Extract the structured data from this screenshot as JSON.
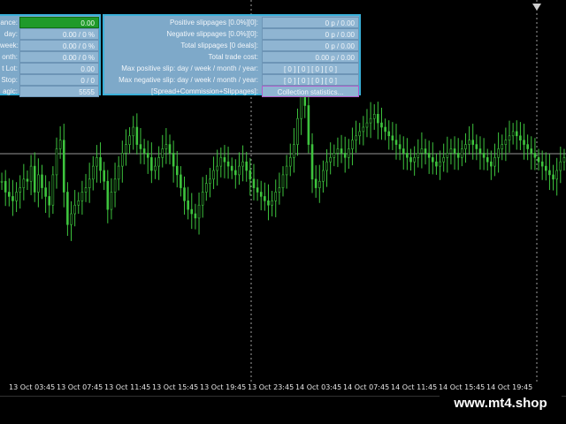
{
  "left_panel": {
    "rows": [
      {
        "label": "ance:",
        "value": "0.00"
      },
      {
        "label": "day:",
        "value": "0.00 / 0 %"
      },
      {
        "label": "week:",
        "value": "0.00 / 0 %"
      },
      {
        "label": "onth:",
        "value": "0.00 / 0 %"
      },
      {
        "label": "t Lot:",
        "value": "0.00"
      },
      {
        "label": "Stop:",
        "value": "0   /   0"
      },
      {
        "label": "agic:",
        "value": "5555"
      }
    ]
  },
  "right_panel": {
    "rows": [
      {
        "label": "Positive slippages [0.0%][0]:",
        "value": "0 p / 0.00"
      },
      {
        "label": "Negative slippages [0.0%][0]:",
        "value": "0 p / 0.00"
      },
      {
        "label": "Total slippages [0 deals]:",
        "value": "0 p / 0.00"
      },
      {
        "label": "Total trade cost:",
        "value": "0.00 p / 0.00"
      },
      {
        "label": "Max positive slip: day / week / month / year:",
        "value": "[ 0 ] [ 0 ] [ 0 ] [ 0 ]"
      },
      {
        "label": "Max negative slip: day / week / month / year:",
        "value": "[ 0 ] [ 0 ] [ 0 ] [ 0 ]"
      },
      {
        "label": "[Spread+Commission+Slippages]:",
        "value": "Collection statistics..."
      }
    ]
  },
  "time_axis": {
    "labels": [
      "13 Oct 03:45",
      "13 Oct 07:45",
      "13 Oct 11:45",
      "13 Oct 15:45",
      "13 Oct 19:45",
      "13 Oct 23:45",
      "14 Oct 03:45",
      "14 Oct 07:45",
      "14 Oct 11:45",
      "14 Oct 15:45",
      "14 Oct 19:45"
    ]
  },
  "watermark": "www.mt4.shop",
  "colors": {
    "candle": "#3ec43e",
    "grid_line": "#c8c8c8",
    "panel_bg": "#7ea9c9",
    "panel_border": "#3ab0d9",
    "balance_bg": "#1f9a2a"
  },
  "chart_data": {
    "type": "line",
    "x": [
      "13 Oct 03:45",
      "13 Oct 07:45",
      "13 Oct 11:45",
      "13 Oct 15:45",
      "13 Oct 19:45",
      "13 Oct 23:45",
      "14 Oct 03:45",
      "14 Oct 07:45",
      "14 Oct 11:45",
      "14 Oct 15:45",
      "14 Oct 19:45"
    ],
    "closes": [
      0.55,
      0.5,
      0.48,
      0.46,
      0.5,
      0.52,
      0.56,
      0.55,
      0.62,
      0.5,
      0.58,
      0.52,
      0.48,
      0.44,
      0.58,
      0.7,
      0.74,
      0.5,
      0.35,
      0.4,
      0.44,
      0.46,
      0.5,
      0.52,
      0.56,
      0.62,
      0.66,
      0.6,
      0.55,
      0.42,
      0.5,
      0.56,
      0.62,
      0.68,
      0.72,
      0.76,
      0.8,
      0.72,
      0.7,
      0.68,
      0.66,
      0.6,
      0.62,
      0.66,
      0.7,
      0.72,
      0.68,
      0.62,
      0.58,
      0.52,
      0.46,
      0.42,
      0.4,
      0.38,
      0.44,
      0.5,
      0.54,
      0.56,
      0.6,
      0.62,
      0.66,
      0.64,
      0.62,
      0.6,
      0.58,
      0.62,
      0.64,
      0.6,
      0.56,
      0.52,
      0.5,
      0.48,
      0.46,
      0.44,
      0.46,
      0.5,
      0.52,
      0.58,
      0.62,
      0.66,
      0.72,
      0.84,
      1.0,
      0.9,
      0.72,
      0.56,
      0.52,
      0.55,
      0.6,
      0.64,
      0.66,
      0.68,
      0.7,
      0.68,
      0.66,
      0.7,
      0.74,
      0.76,
      0.78,
      0.8,
      0.82,
      0.84,
      0.86,
      0.82,
      0.8,
      0.78,
      0.76,
      0.74,
      0.72,
      0.7,
      0.68,
      0.66,
      0.64,
      0.66,
      0.68,
      0.7,
      0.68,
      0.66,
      0.64,
      0.62,
      0.64,
      0.66,
      0.68,
      0.7,
      0.68,
      0.66,
      0.7,
      0.72,
      0.74,
      0.72,
      0.7,
      0.68,
      0.66,
      0.64,
      0.62,
      0.66,
      0.7,
      0.72,
      0.74,
      0.76,
      0.78,
      0.76,
      0.74,
      0.72,
      0.7,
      0.68,
      0.66,
      0.64,
      0.62,
      0.6,
      0.58,
      0.56,
      0.6,
      0.64,
      0.66
    ]
  }
}
